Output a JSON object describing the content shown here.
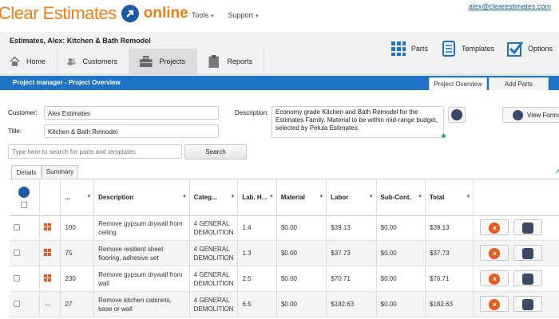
{
  "brand": {
    "name_left": "Clear Estimates",
    "name_right": "online",
    "orange": "#f07d1a",
    "blue": "#1c5aa8"
  },
  "top_nav": {
    "tools": "Tools",
    "support": "Support",
    "user_email": "alex@clearestimates.com"
  },
  "project_title": "Estimates, Alex: Kitchen & Bath Remodel",
  "main_tabs": [
    "Home",
    "Customers",
    "Projects",
    "Reports"
  ],
  "active_tab": "Projects",
  "tools": {
    "parts": "Parts",
    "templates": "Templates",
    "options": "Options"
  },
  "bluebar": {
    "title": "Project manager - Project Overview",
    "accent": "#1e73c7"
  },
  "sub_tabs": {
    "overview": "Project Overview",
    "add_parts": "Add Parts"
  },
  "form": {
    "customer_label": "Customer:",
    "customer_value": "Alex Estimates",
    "title_label": "Title:",
    "title_value": "Kitchen & Bath Remodel",
    "description_label": "Description:",
    "description_value": "Economy grade Kitchen and Bath Remodel for the Estimates Family. Material to be within mid-range budget, selected by Petula Estimates.",
    "view_forms": "View Forms"
  },
  "search": {
    "placeholder": "Type here to search for parts and templates",
    "button": "Search"
  },
  "detail_tabs": {
    "details": "Details",
    "summary": "Summary"
  },
  "table": {
    "headers": [
      "...",
      "Description",
      "Categ...",
      "Lab. H...",
      "Material",
      "Labor",
      "Sub-Cont.",
      "Total"
    ],
    "rows": [
      {
        "qty": "100",
        "icon": "grid-icon",
        "description": "Remove gypsum drywall from ceiling",
        "category": "4 GENERAL DEMOLITION",
        "lab_hours": "1.4",
        "material": "$0.00",
        "labor": "$39.13",
        "subcont": "$0.00",
        "total": "$39.13"
      },
      {
        "qty": "75",
        "icon": "grid-icon",
        "description": "Remove resilient sheet flooring, adhesive set",
        "category": "4 GENERAL DEMOLITION",
        "lab_hours": "1.3",
        "material": "$0.00",
        "labor": "$37.73",
        "subcont": "$0.00",
        "total": "$37.73"
      },
      {
        "qty": "230",
        "icon": "grid-icon",
        "description": "Remove gypsum drywall from wall",
        "category": "4 GENERAL DEMOLITION",
        "lab_hours": "2.5",
        "material": "$0.00",
        "labor": "$70.71",
        "subcont": "$0.00",
        "total": "$70.71"
      },
      {
        "qty": "27",
        "icon": "arrows-icon",
        "description": "Remove kitchen cabinets, base or wall",
        "category": "4 GENERAL DEMOLITION",
        "lab_hours": "6.5",
        "material": "$0.00",
        "labor": "$182.63",
        "subcont": "$0.00",
        "total": "$182.63"
      }
    ]
  }
}
